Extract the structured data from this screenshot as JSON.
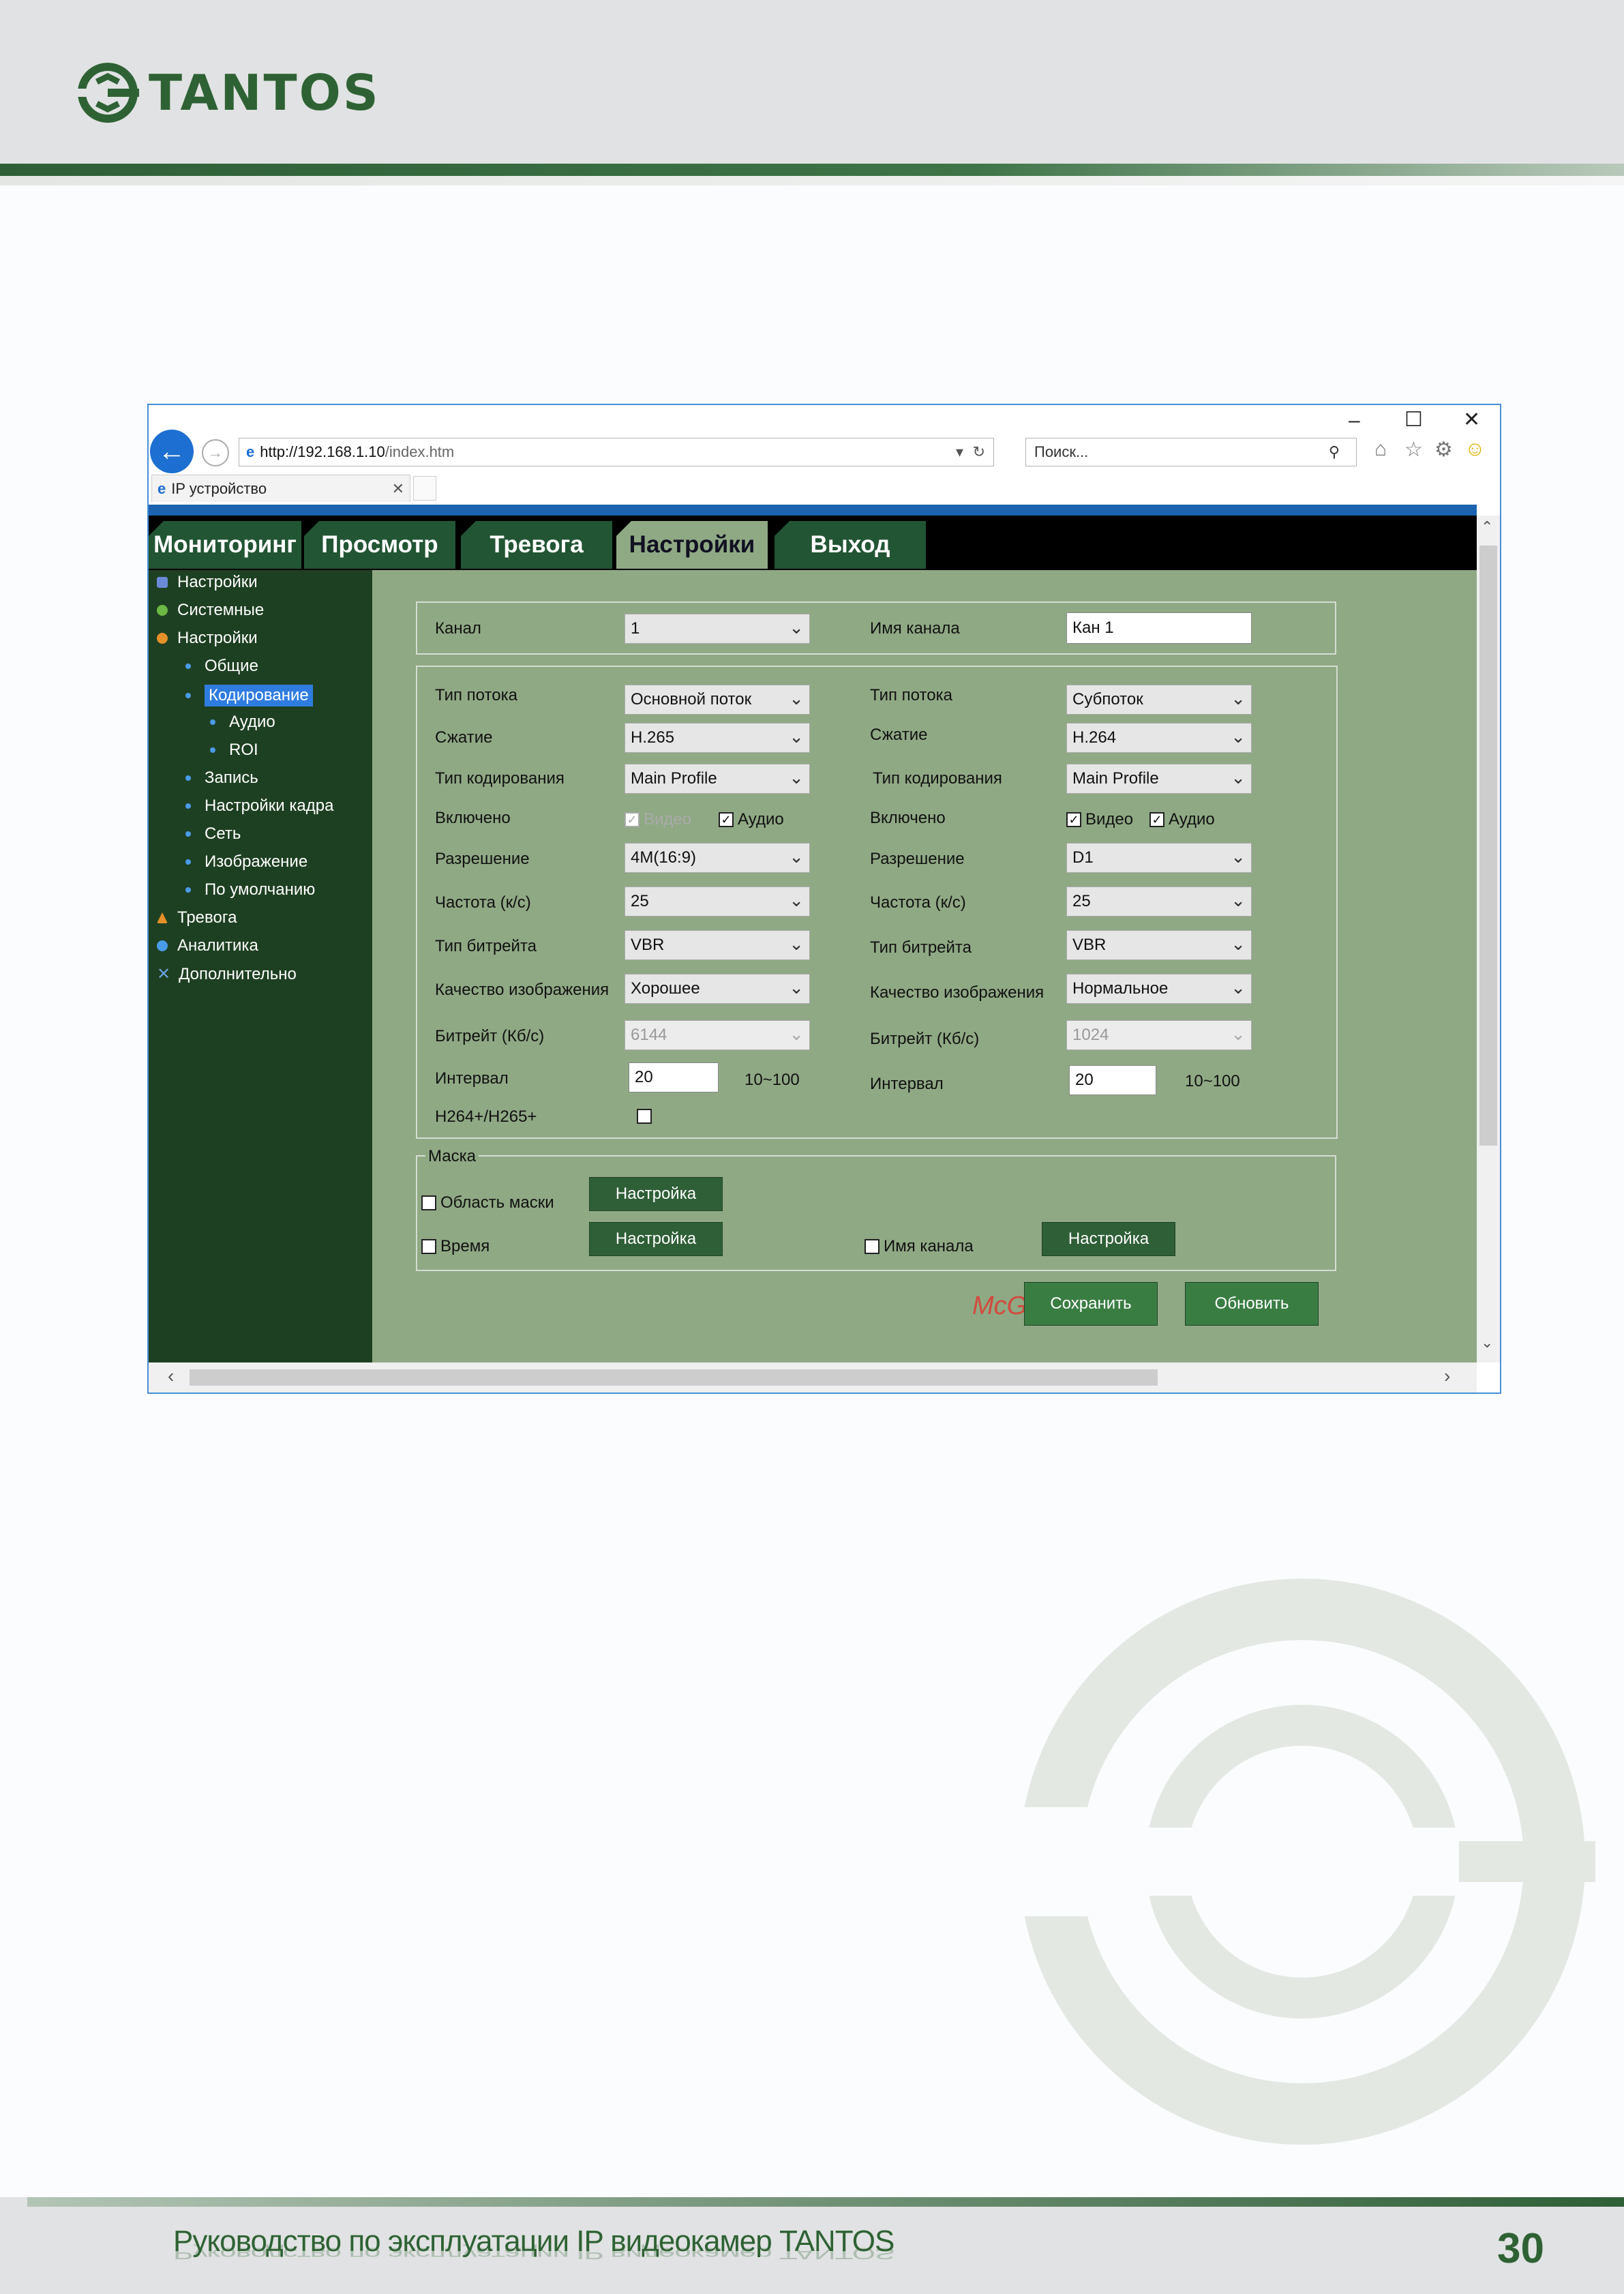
{
  "header": {
    "logo_text": "TANTOS"
  },
  "footer": {
    "title": "Руководство по эксплуатации IP видеокамер TANTOS",
    "page": "30"
  },
  "browser": {
    "url_host": "http://192.168.1.10",
    "url_path": "/index.htm",
    "search_placeholder": "Поиск...",
    "tab_title": "IP устройство",
    "min": "–",
    "max": "☐",
    "close": "✕"
  },
  "nav": {
    "tabs": [
      "Мониторинг",
      "Просмотр",
      "Тревога",
      "Настройки",
      "Выход"
    ],
    "active": "Настройки"
  },
  "sidebar": {
    "items": [
      "Настройки",
      "Системные",
      "Настройки",
      "Общие",
      "Кодирование",
      "Аудио",
      "ROI",
      "Запись",
      "Настройки кадра",
      "Сеть",
      "Изображение",
      "По умолчанию",
      "Тревога",
      "Аналитика",
      "Дополнительно"
    ]
  },
  "channel": {
    "label": "Канал",
    "value": "1",
    "name_label": "Имя канала",
    "name_value": "Кан 1"
  },
  "main_stream": {
    "type_label": "Тип потока",
    "type": "Основной поток",
    "compress_label": "Сжатие",
    "compress": "H.265",
    "profile_label": "Тип кодирования",
    "profile": "Main Profile",
    "enabled_label": "Включено",
    "video": "Видео",
    "audio": "Аудио",
    "res_label": "Разрешение",
    "res": "4M(16:9)",
    "fps_label": "Частота (к/с)",
    "fps": "25",
    "bitrate_type_label": "Тип битрейта",
    "bitrate_type": "VBR",
    "quality_label": "Качество изображения",
    "quality": "Хорошее",
    "bitrate_label": "Битрейт (Кб/с)",
    "bitrate": "6144",
    "interval_label": "Интервал",
    "interval": "20",
    "interval_range": "10~100",
    "plus_label": "H264+/H265+"
  },
  "sub_stream": {
    "type_label": "Тип потока",
    "type": "Субпоток",
    "compress_label": "Сжатие",
    "compress": "H.264",
    "profile_label": "Тип кодирования",
    "profile": "Main Profile",
    "enabled_label": "Включено",
    "video": "Видео",
    "audio": "Аудио",
    "res_label": "Разрешение",
    "res": "D1",
    "fps_label": "Частота (к/с)",
    "fps": "25",
    "bitrate_type_label": "Тип битрейта",
    "bitrate_type": "VBR",
    "quality_label": "Качество изображения",
    "quality": "Нормальное",
    "bitrate_label": "Битрейт (Кб/с)",
    "bitrate": "1024",
    "interval_label": "Интервал",
    "interval": "20",
    "interval_range": "10~100"
  },
  "mask": {
    "legend": "Маска",
    "area": "Область маски",
    "time": "Время",
    "chname": "Имя канала",
    "setup": "Настройка"
  },
  "actions": {
    "save": "Сохранить",
    "refresh": "Обновить"
  },
  "watermark_text": "McGrp.Ru",
  "colors": {
    "brand_green": "#2e6234",
    "content_bg": "#8fa984",
    "sidebar_bg": "#1e4022"
  }
}
